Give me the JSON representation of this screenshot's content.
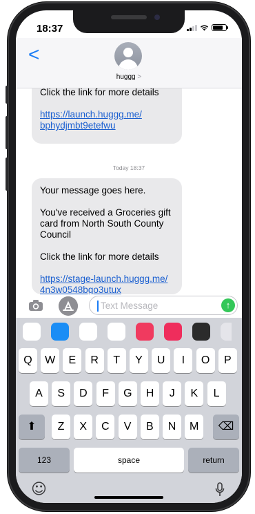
{
  "status_bar": {
    "time": "18:37"
  },
  "header": {
    "back_label": "<",
    "contact_name": "huggg",
    "contact_chevron": ">"
  },
  "messages": {
    "first": {
      "line1": "Click the link for more details",
      "link": "https://launch.huggg.me/ bphydjmbt9etefwu"
    },
    "timestamp": {
      "day": "Today",
      "time": "18:37"
    },
    "second": {
      "line1": "Your message goes here.",
      "line2": "You've received a Groceries gift card from North South County Council",
      "line3": "Click the link for more details",
      "link": "https://stage-launch.huggg.me/ 4n3w0548bgo3utux"
    }
  },
  "input": {
    "placeholder": "Text Message",
    "send_icon": "↑"
  },
  "app_strip": [
    {
      "name": "photos-app",
      "color": "#ffffff"
    },
    {
      "name": "app-store-app",
      "color": "#1a8df5"
    },
    {
      "name": "memoji-app",
      "color": "#ffffff"
    },
    {
      "name": "stickers-app",
      "color": "#ffffff"
    },
    {
      "name": "search-images-app",
      "color": "#f03a5f"
    },
    {
      "name": "digital-touch-app",
      "color": "#ef2d5c"
    },
    {
      "name": "music-app",
      "color": "#2b2b2b"
    },
    {
      "name": "more-app",
      "color": "#e5e5ea"
    }
  ],
  "keyboard": {
    "row1": [
      "Q",
      "W",
      "E",
      "R",
      "T",
      "Y",
      "U",
      "I",
      "O",
      "P"
    ],
    "row2": [
      "A",
      "S",
      "D",
      "F",
      "G",
      "H",
      "J",
      "K",
      "L"
    ],
    "row3": [
      "Z",
      "X",
      "C",
      "V",
      "B",
      "N",
      "M"
    ],
    "shift_icon": "⬆",
    "delete_icon": "⌫",
    "numbers_label": "123",
    "space_label": "space",
    "return_label": "return",
    "emoji_icon": "☺",
    "mic_icon": "🎙"
  }
}
